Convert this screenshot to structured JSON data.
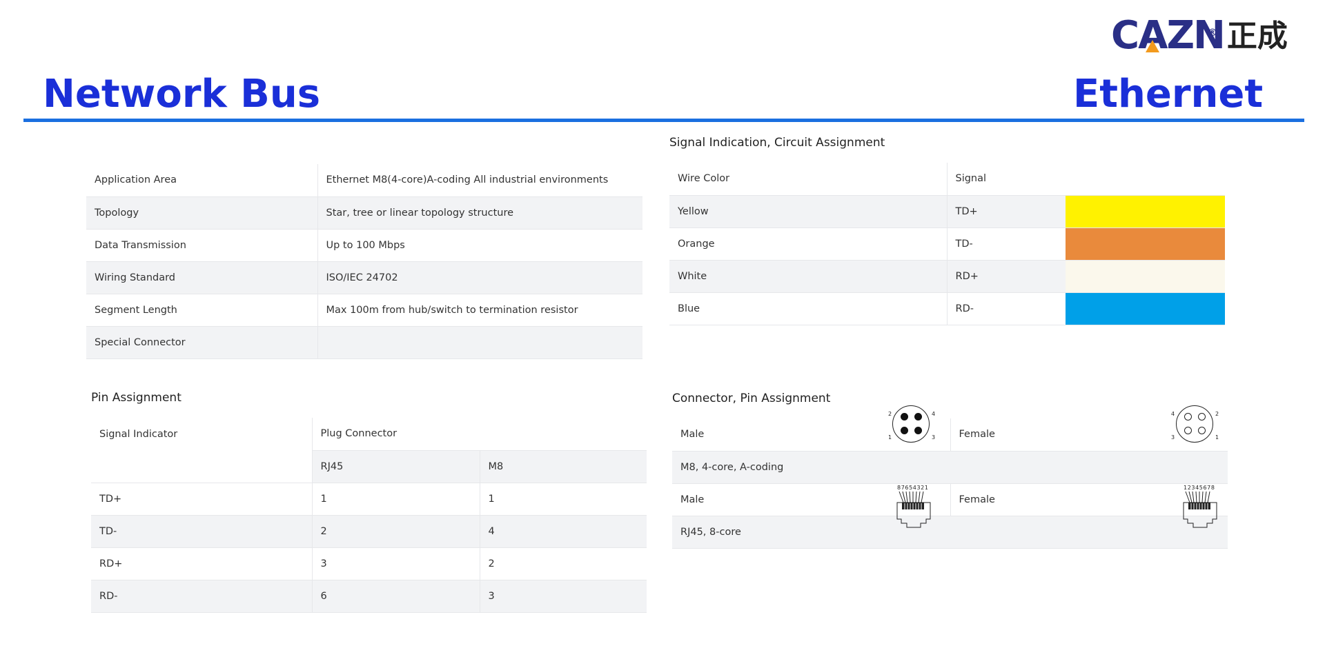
{
  "brand": {
    "latin": "CAZN",
    "cjk": "正成",
    "reg": "®"
  },
  "header": {
    "left_title": "Network Bus",
    "right_title": "Ethernet"
  },
  "spec_table": [
    {
      "label": "Application Area",
      "value": "Ethernet M8(4-core)A-coding All industrial environments"
    },
    {
      "label": "Topology",
      "value": "Star, tree or linear topology structure"
    },
    {
      "label": "Data Transmission",
      "value": "Up to 100 Mbps"
    },
    {
      "label": "Wiring Standard",
      "value": "ISO/IEC 24702"
    },
    {
      "label": "Segment Length",
      "value": "Max 100m from hub/switch to termination resistor"
    },
    {
      "label": "Special Connector",
      "value": ""
    }
  ],
  "signal_section": {
    "caption": "Signal Indication, Circuit Assignment",
    "header": {
      "col1": "Wire Color",
      "col2": "Signal"
    },
    "rows": [
      {
        "color_name": "Yellow",
        "signal": "TD+",
        "swatch": "#fff200"
      },
      {
        "color_name": "Orange",
        "signal": "TD-",
        "swatch": "#e98a3c"
      },
      {
        "color_name": "White",
        "signal": "RD+",
        "swatch": "#fbf8ec"
      },
      {
        "color_name": "Blue",
        "signal": "RD-",
        "swatch": "#00a0e8"
      }
    ]
  },
  "pin_section": {
    "caption": "Pin Assignment",
    "header": {
      "signal_indicator": "Signal Indicator",
      "plug_connector": "Plug Connector",
      "rj45": "RJ45",
      "m8": "M8"
    },
    "rows": [
      {
        "signal": "TD+",
        "rj45": "1",
        "m8": "1"
      },
      {
        "signal": "TD-",
        "rj45": "2",
        "m8": "4"
      },
      {
        "signal": "RD+",
        "rj45": "3",
        "m8": "2"
      },
      {
        "signal": "RD-",
        "rj45": "6",
        "m8": "3"
      }
    ]
  },
  "connector_section": {
    "caption": "Connector, Pin Assignment",
    "male_label": "Male",
    "female_label": "Female",
    "m8_desc": "M8, 4-core, A-coding",
    "rj45_desc": "RJ45, 8-core",
    "m8_male_pins": [
      "2",
      "4",
      "1",
      "3"
    ],
    "m8_female_pins": [
      "4",
      "2",
      "3",
      "1"
    ],
    "rj45_male_pins": "87654321",
    "rj45_female_pins": "12345678"
  },
  "colors": {
    "title_blue": "#1a2fd8",
    "rule_blue": "#1a6fe0",
    "logo_navy": "#2a2f86",
    "logo_orange": "#f39a1d"
  }
}
